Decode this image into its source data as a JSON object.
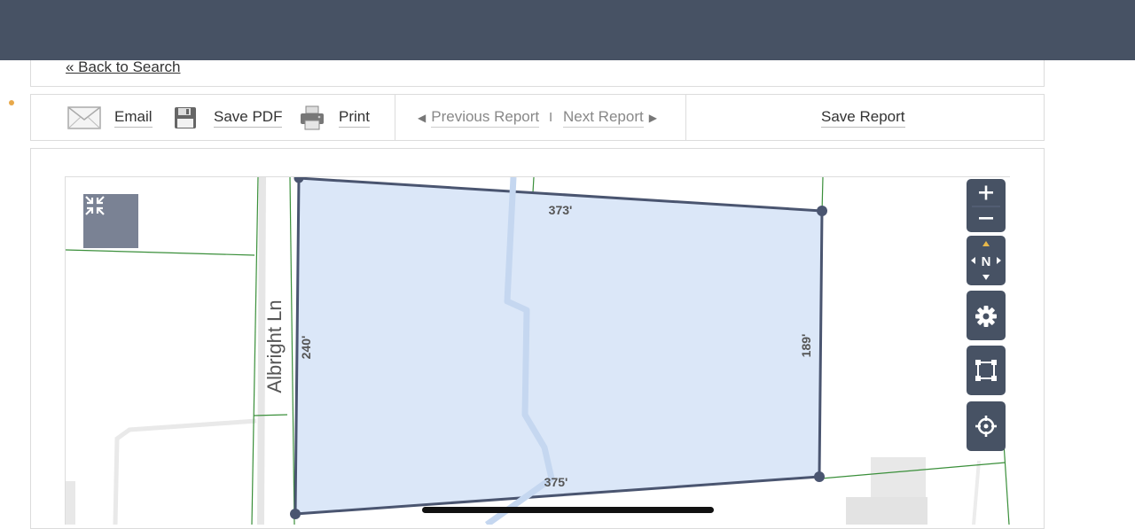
{
  "nav": {
    "back_link": "« Back to Search"
  },
  "toolbar": {
    "email": {
      "label": "Email",
      "icon": "envelope-icon"
    },
    "save_pdf": {
      "label": "Save PDF",
      "icon": "floppy-disk-icon"
    },
    "print": {
      "label": "Print",
      "icon": "printer-icon"
    },
    "previous_report": "Previous Report",
    "separator": "I",
    "next_report": "Next Report",
    "save_report": "Save Report"
  },
  "map": {
    "street_label": "Albright Ln",
    "dimensions": {
      "top": "373'",
      "right": "189'",
      "bottom": "375'",
      "left": "240'"
    },
    "controls": [
      "collapse-icon",
      "zoom-in-icon",
      "zoom-out-icon",
      "compass-north-icon",
      "gear-icon",
      "select-box-icon",
      "locate-crosshair-icon"
    ],
    "compass_label": "N",
    "colors": {
      "parcel_fill": "#dbe7f8",
      "parcel_stroke": "#4a5570",
      "parcel_lines": "#2e8b2e",
      "controls_bg": "#475264",
      "header_bg": "#475264"
    }
  }
}
